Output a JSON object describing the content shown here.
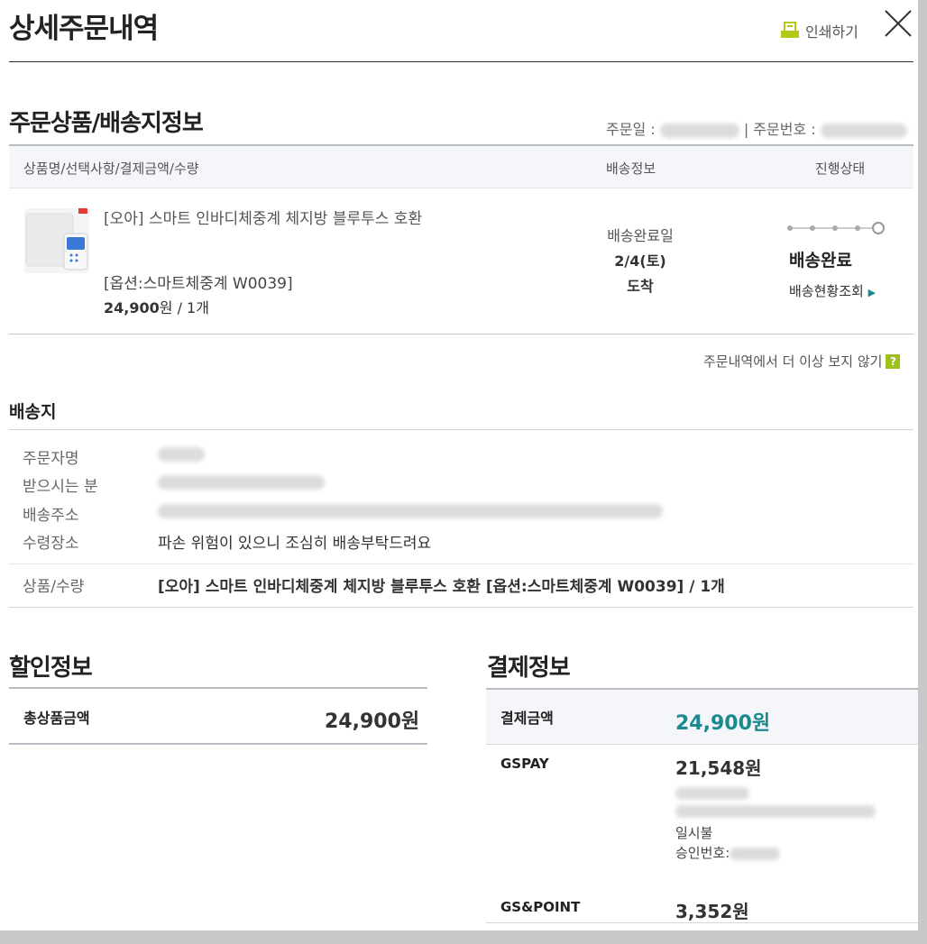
{
  "header": {
    "title": "상세주문내역",
    "print_label": "인쇄하기"
  },
  "order_section": {
    "title": "주문상품/배송지정보",
    "order_date_label": "주문일 :",
    "order_no_label": "| 주문번호 :",
    "columns": [
      "상품명/선택사항/결제금액/수량",
      "배송정보",
      "진행상태"
    ],
    "product": {
      "name": "[오아] 스마트 인바디체중계 체지방 블루투스 호환",
      "option": "[옵션:스마트체중계 W0039]",
      "price": "24,900",
      "price_unit": "원",
      "qty": "/ 1개"
    },
    "shipping": {
      "label": "배송완료일",
      "date": "2/4(토)",
      "arrived": "도착"
    },
    "status": {
      "text": "배송완료",
      "track_label": "배송현황조회",
      "track_arrow": "▶"
    },
    "hide_label": "주문내역에서 더 이상 보지 않기",
    "hide_help": "?"
  },
  "delivery": {
    "title": "배송지",
    "rows": [
      {
        "label": "주문자명",
        "value": ""
      },
      {
        "label": "받으시는 분",
        "value": ""
      },
      {
        "label": "배송주소",
        "value": ""
      },
      {
        "label": "수령장소",
        "value": "파손 위험이 있으니 조심히 배송부탁드려요"
      }
    ],
    "product_qty_label": "상품/수량",
    "product_qty_value": "[오아] 스마트 인바디체중계 체지방 블루투스 호환 [옵션:스마트체중계 W0039] / 1개"
  },
  "discount": {
    "title": "할인정보",
    "total_label": "총상품금액",
    "total_value": "24,900원"
  },
  "payment": {
    "title": "결제정보",
    "pay_label": "결제금액",
    "pay_value": "24,900원",
    "gspay_label": "GSPAY",
    "gspay_value": "21,548원",
    "installment": "일시불",
    "approval_label": "승인번호:",
    "point_label": "GS&POINT",
    "point_value": "3,352원"
  },
  "colors": {
    "accent": "#1a8a8e",
    "help_badge": "#9fc11f"
  }
}
